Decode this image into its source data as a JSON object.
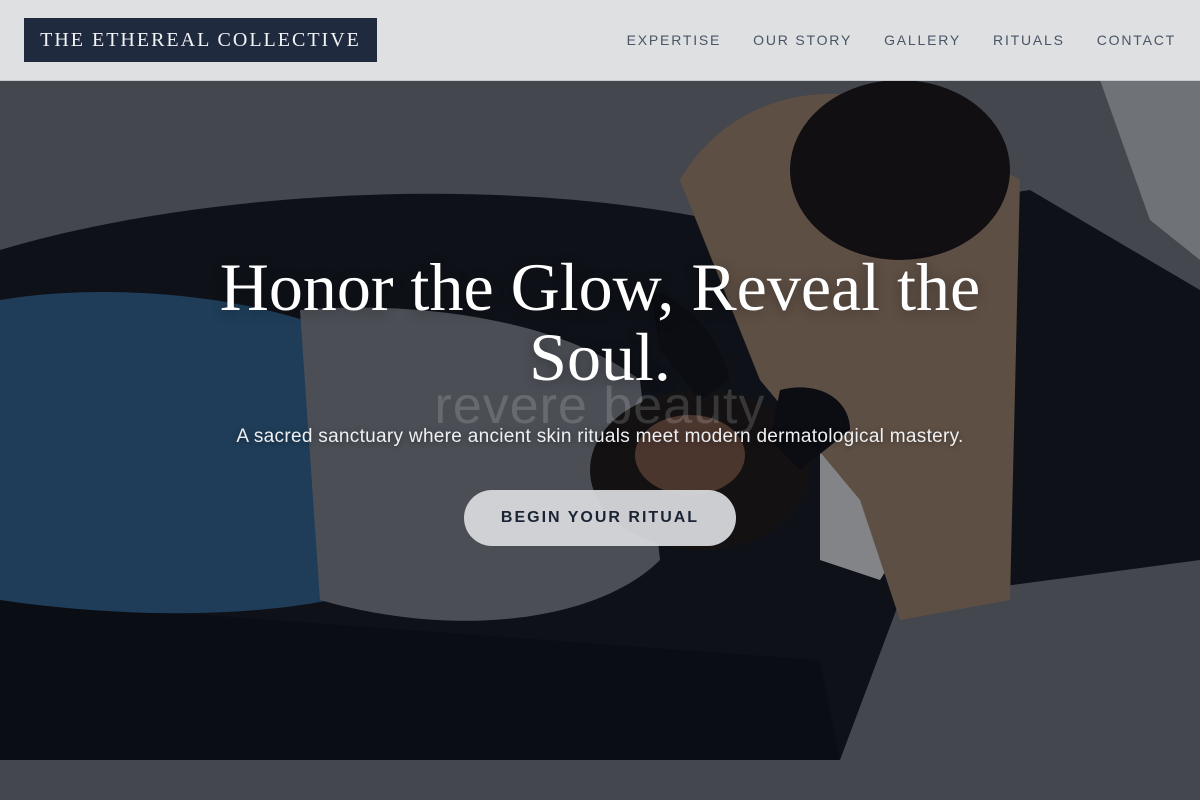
{
  "brand": {
    "name": "THE ETHEREAL COLLECTIVE"
  },
  "nav": {
    "items": [
      {
        "label": "EXPERTISE"
      },
      {
        "label": "OUR STORY"
      },
      {
        "label": "GALLERY"
      },
      {
        "label": "RITUALS"
      },
      {
        "label": "CONTACT"
      }
    ]
  },
  "hero": {
    "title": "Honor the Glow, Reveal the Soul.",
    "watermark": "revere beauty",
    "subtitle": "A sacred sanctuary where ancient skin rituals meet modern dermatological mastery.",
    "cta_label": "BEGIN YOUR RITUAL"
  },
  "colors": {
    "brand_navy": "#1f2a3f",
    "header_bg": "#e8eaec",
    "nav_text": "#4a5566",
    "cta_bg": "#d6d8db",
    "cta_text": "#1b2435"
  }
}
